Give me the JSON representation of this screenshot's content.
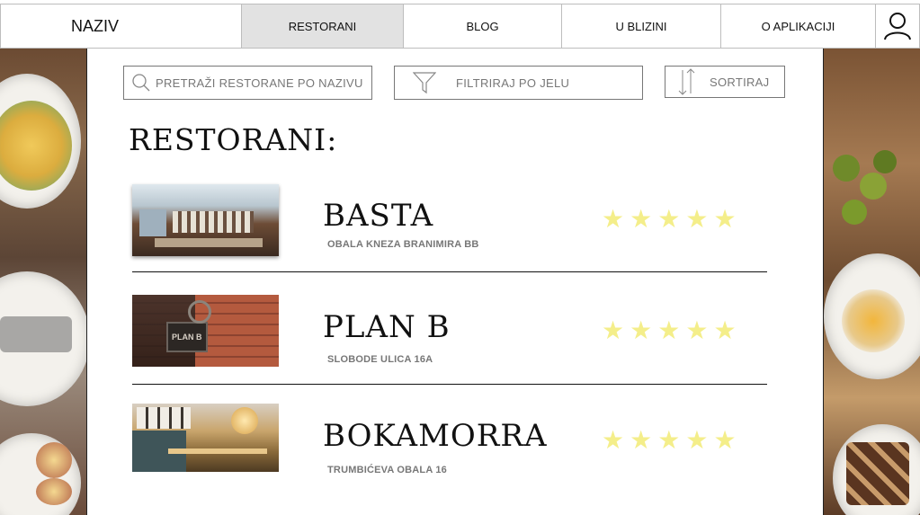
{
  "nav": {
    "brand": "NAZIV",
    "items": [
      {
        "label": "RESTORANI",
        "active": true
      },
      {
        "label": "BLOG",
        "active": false
      },
      {
        "label": "U BLIZINI",
        "active": false
      },
      {
        "label": "O APLIKACIJI",
        "active": false
      }
    ],
    "user_icon": "user-icon"
  },
  "toolbar": {
    "search_placeholder": "PRETRAŽI RESTORANE PO NAZIVU",
    "search_icon": "search-icon",
    "filter_label": "FILTRIRAJ PO JELU",
    "filter_icon": "funnel-icon",
    "sort_label": "SORTIRAJ",
    "sort_icon": "sort-arrows-icon"
  },
  "main": {
    "title": "RESTORANI:",
    "restaurants": [
      {
        "name": "BASTA",
        "address": "OBALA KNEZA BRANIMIRA BB",
        "rating": 5
      },
      {
        "name": "PLAN B",
        "address": "SLOBODE ULICA 16A",
        "rating": 5
      },
      {
        "name": "BOKAMORRA",
        "address": "TRUMBIĆEVA OBALA 16",
        "rating": 5
      }
    ]
  },
  "colors": {
    "star": "#f4ee8a",
    "active_nav": "#e2e2e2",
    "muted_text": "#777777"
  }
}
